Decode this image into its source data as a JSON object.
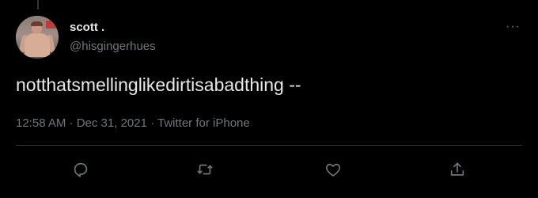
{
  "tweet": {
    "author_name": "scott .",
    "author_handle": "@hisgingerhues",
    "text": "notthatsmellinglikedirtisabadthing --",
    "meta": "12:58 AM · Dec 31, 2021 · Twitter for iPhone",
    "more_label": "···"
  },
  "actions": {
    "icons": [
      "reply-icon",
      "retweet-icon",
      "like-icon",
      "share-icon"
    ]
  },
  "colors": {
    "background": "#000000",
    "primary_text": "#e7e9ea",
    "secondary_text": "#71767b",
    "divider": "#2f3336"
  }
}
